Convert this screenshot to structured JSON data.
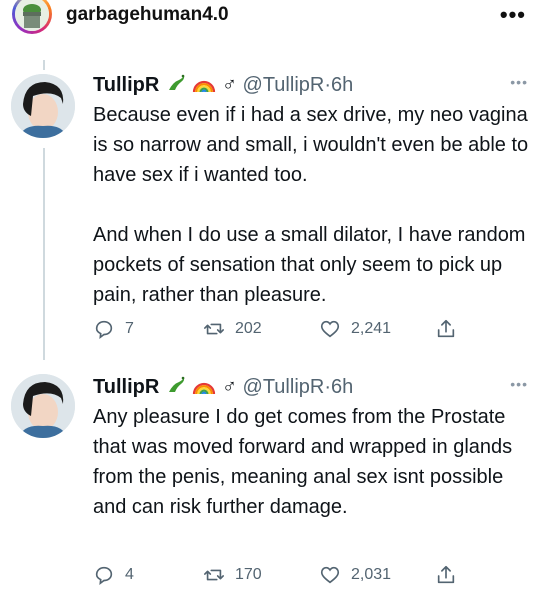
{
  "instagram": {
    "username": "garbagehuman4.0",
    "menu_icon": "more-horizontal-icon"
  },
  "tweets": [
    {
      "name": "TullipR",
      "emoji_icons": [
        "lizard-emoji",
        "rainbow-emoji",
        "male-sign-icon"
      ],
      "male_sign": "♂",
      "handle": "@TullipR",
      "separator": "·",
      "time": "6h",
      "text": "Because even if i had a sex drive, my neo vagina is so narrow and small, i wouldn't even be able to have sex if i wanted too.\n\nAnd when I do use a small dilator, I have random pockets of sensation that only seem to pick up pain, rather than pleasure.",
      "replies": "7",
      "retweets": "202",
      "likes": "2,241"
    },
    {
      "name": "TullipR",
      "emoji_icons": [
        "lizard-emoji",
        "rainbow-emoji",
        "male-sign-icon"
      ],
      "male_sign": "♂",
      "handle": "@TullipR",
      "separator": "·",
      "time": "6h",
      "text": "Any pleasure I do get comes from the Prostate that was moved forward and wrapped in glands from the penis, meaning anal sex isnt possible and can risk further damage.",
      "replies": "4",
      "retweets": "170",
      "likes": "2,031"
    }
  ],
  "colors": {
    "text": "#0f1419",
    "secondary": "#536471",
    "thread_line": "#cfd9de"
  }
}
